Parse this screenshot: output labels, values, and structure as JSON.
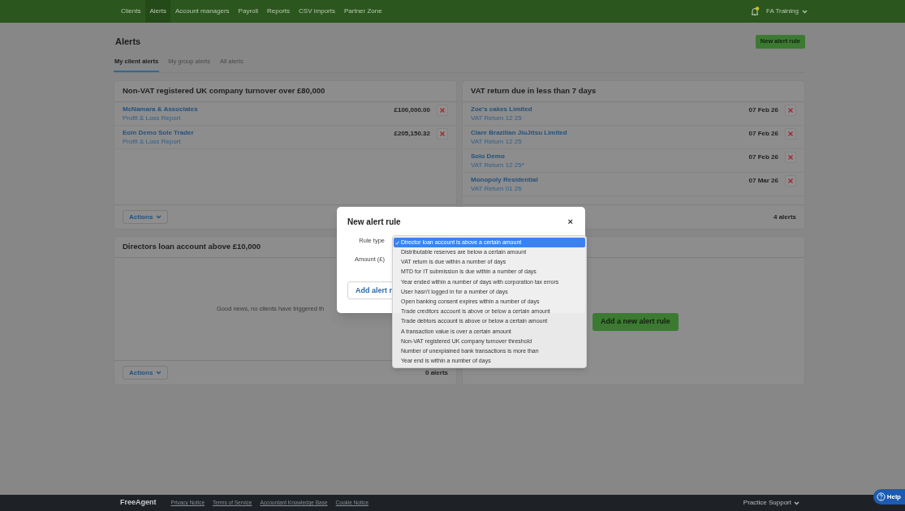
{
  "nav": {
    "items": [
      {
        "label": "Clients",
        "selected": false
      },
      {
        "label": "Alerts",
        "selected": true
      },
      {
        "label": "Account managers",
        "selected": false
      },
      {
        "label": "Payroll",
        "selected": false
      },
      {
        "label": "Reports",
        "selected": false
      },
      {
        "label": "CSV imports",
        "selected": false
      },
      {
        "label": "Partner Zone",
        "selected": false
      }
    ],
    "notification": true,
    "user": "FA Training"
  },
  "page": {
    "title": "Alerts",
    "new_button": "New alert rule",
    "tabs": [
      {
        "label": "My client alerts",
        "selected": true
      },
      {
        "label": "My group alerts",
        "selected": false
      },
      {
        "label": "All alerts",
        "selected": false
      }
    ]
  },
  "cards": [
    {
      "kind": "list",
      "title": "Non-VAT registered UK company turnover over £80,000",
      "rows": [
        {
          "name": "McNamara & Associates",
          "detail": "Profit & Loss Report",
          "value": "£100,000.00"
        },
        {
          "name": "Eoin Demo Sole Trader",
          "detail": "Profit & Loss Report",
          "value": "£205,150.32"
        }
      ],
      "actions": "Actions"
    },
    {
      "kind": "list",
      "title": "VAT return due in less than 7 days",
      "rows": [
        {
          "name": "Zoe's cakes Limited",
          "detail": "VAT Return 12 25",
          "value": "07 Feb 26"
        },
        {
          "name": "Clare Brazilian JiuJitsu Limited",
          "detail": "VAT Return 12 25",
          "value": "07 Feb 26"
        },
        {
          "name": "Solo Demo",
          "detail": "VAT Return 12 25*",
          "value": "07 Feb 26"
        },
        {
          "name": "Monopoly Residential",
          "detail": "VAT Return 01 26",
          "value": "07 Mar 26"
        }
      ],
      "count": "4 alerts"
    },
    {
      "kind": "empty",
      "title": "Directors loan account above £10,000",
      "message": "Good news, no clients have triggered th",
      "actions": "Actions",
      "count": "0 alerts"
    },
    {
      "kind": "promo",
      "button": "Add a new alert rule"
    }
  ],
  "modal": {
    "title": "New alert rule",
    "close": "×",
    "fields": [
      {
        "label": "Rule type"
      },
      {
        "label": "Amount (£)"
      }
    ],
    "submit": "Add alert r",
    "options": [
      {
        "label": "Director loan account is above a certain amount",
        "selected": true
      },
      {
        "label": "Distributable reserves are below a certain amount",
        "selected": false
      },
      {
        "label": "VAT return is due within a number of days",
        "selected": false
      },
      {
        "label": "MTD for IT submission is due within a number of days",
        "selected": false
      },
      {
        "label": "Year ended within a number of days with corporation tax errors",
        "selected": false
      },
      {
        "label": "User hasn't logged in for a number of days",
        "selected": false
      },
      {
        "label": "Open banking consent expires within a number of days",
        "selected": false
      },
      {
        "label": "Trade creditors account is above or below a certain amount",
        "selected": false
      },
      {
        "label": "Trade debtors account is above or below a certain amount",
        "selected": false
      },
      {
        "label": "A transaction value is over a certain amount",
        "selected": false
      },
      {
        "label": "Non-VAT registered UK company turnover threshold",
        "selected": false
      },
      {
        "label": "Number of unexplained bank transactions is more than",
        "selected": false
      },
      {
        "label": "Year end is within a number of days",
        "selected": false
      }
    ]
  },
  "footer": {
    "logo": "FreeAgent",
    "links": [
      "Privacy Notice",
      "Terms of Service",
      "Accountant Knowledge Base",
      "Cookie Notice"
    ],
    "support": "Practice Support",
    "help": "Help"
  }
}
